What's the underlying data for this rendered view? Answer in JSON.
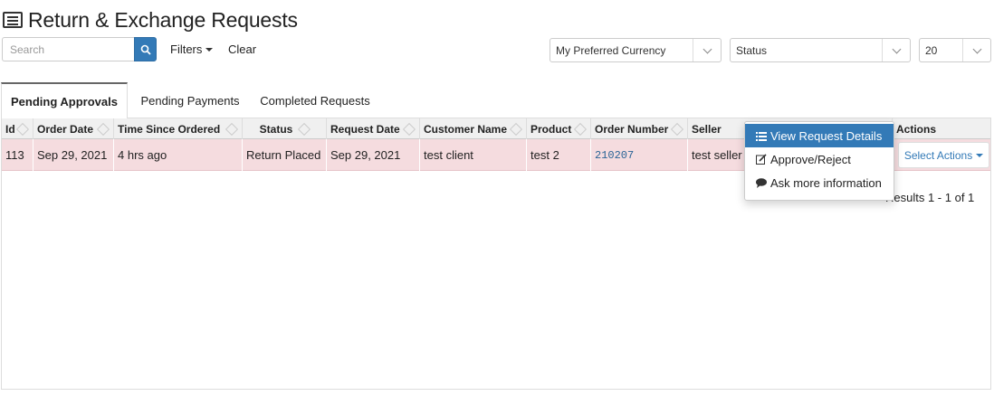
{
  "page": {
    "title": "Return & Exchange Requests"
  },
  "toolbar": {
    "search_placeholder": "Search",
    "filters_label": "Filters",
    "clear_label": "Clear",
    "currency_select": "My Preferred Currency",
    "status_select": "Status",
    "page_size": "20"
  },
  "tabs": [
    {
      "label": "Pending Approvals",
      "active": true
    },
    {
      "label": "Pending Payments",
      "active": false
    },
    {
      "label": "Completed Requests",
      "active": false
    }
  ],
  "table": {
    "columns": [
      "Id",
      "Order Date",
      "Time Since Ordered",
      "Status",
      "Request Date",
      "Customer Name",
      "Product",
      "Order Number",
      "Seller",
      "Actions"
    ],
    "rows": [
      {
        "id": "113",
        "order_date": "Sep 29, 2021",
        "time_since": "4 hrs ago",
        "status": "Return Placed",
        "request_date": "Sep 29, 2021",
        "customer": "test client",
        "product": "test 2",
        "order_number": "210207",
        "seller": "test seller",
        "action_label": "Select Actions"
      }
    ],
    "results_text": "Results 1 - 1 of 1"
  },
  "actions_menu": {
    "items": [
      {
        "label": "View Request Details",
        "icon": "list-icon",
        "active": true
      },
      {
        "label": "Approve/Reject",
        "icon": "edit-icon",
        "active": false
      },
      {
        "label": "Ask more information",
        "icon": "comment-icon",
        "active": false
      }
    ]
  },
  "colors": {
    "accent": "#337ab7",
    "row_highlight": "#f5dcdf"
  }
}
